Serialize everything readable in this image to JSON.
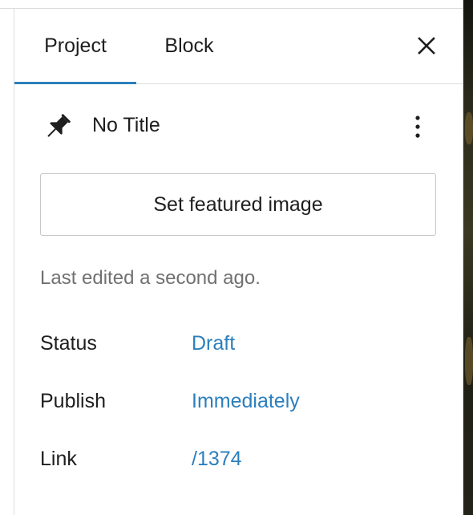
{
  "tabs": {
    "project_label": "Project",
    "block_label": "Block",
    "active": "Project"
  },
  "post": {
    "title": "No Title"
  },
  "featured_image": {
    "button_label": "Set featured image"
  },
  "last_edited": "Last edited a second ago.",
  "meta": {
    "status": {
      "label": "Status",
      "value": "Draft"
    },
    "publish": {
      "label": "Publish",
      "value": "Immediately"
    },
    "link": {
      "label": "Link",
      "value": "/1374"
    }
  },
  "colors": {
    "accent": "#2c7fbd",
    "text": "#1e1e1e",
    "muted": "#707070",
    "border": "#dcdcde"
  },
  "icons": {
    "close": "close-icon",
    "pin": "pin-icon",
    "more": "more-vertical-icon"
  }
}
